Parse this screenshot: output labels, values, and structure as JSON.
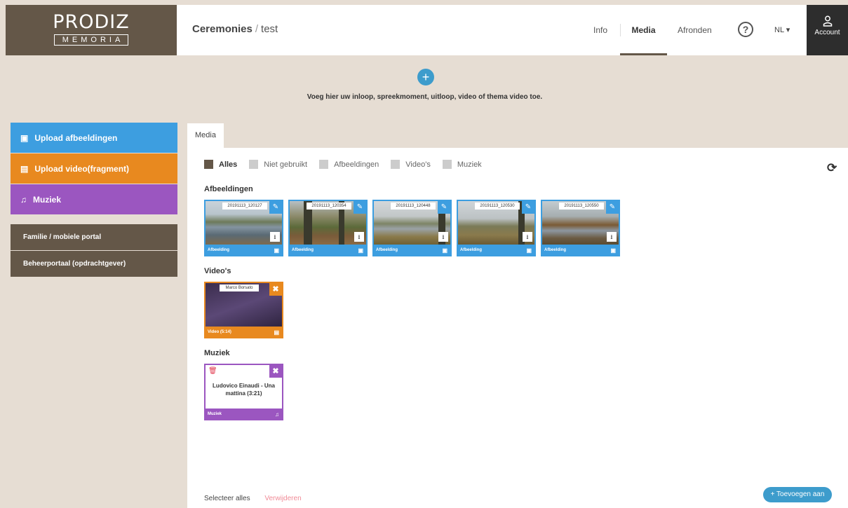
{
  "brand": {
    "name": "PRODIZ",
    "sub": "MEMORIA"
  },
  "header": {
    "crumb_main": "Ceremonies",
    "crumb_sep": "/",
    "crumb_sub": "test",
    "nav": {
      "info": "Info",
      "media": "Media",
      "afronden": "Afronden"
    },
    "help": "?",
    "lang": "NL ▾",
    "account": "Account"
  },
  "addbar": {
    "plus": "+",
    "text": "Voeg hier uw inloop, spreekmoment, uitloop, video of thema video toe."
  },
  "sidebar": {
    "upload_images": "Upload afbeeldingen",
    "upload_video": "Upload video(fragment)",
    "music": "Muziek",
    "family_portal": "Familie / mobiele portal",
    "admin_portal": "Beheerportaal (opdrachtgever)"
  },
  "media": {
    "tab": "Media",
    "filters": [
      "Alles",
      "Niet gebruikt",
      "Afbeeldingen",
      "Video's",
      "Muziek"
    ],
    "headings": {
      "images": "Afbeeldingen",
      "videos": "Video's",
      "music": "Muziek"
    },
    "images": [
      {
        "caption": "20191113_120127",
        "type": "Afbeelding"
      },
      {
        "caption": "20191113_120354",
        "type": "Afbeelding"
      },
      {
        "caption": "20191113_120448",
        "type": "Afbeelding"
      },
      {
        "caption": "20191113_120530",
        "type": "Afbeelding"
      },
      {
        "caption": "20191113_120550",
        "type": "Afbeelding"
      }
    ],
    "video": {
      "caption": "Marco Borsato",
      "type": "Video (5:14)"
    },
    "music_item": {
      "title": "Ludovico Einaudi - Una mattina (3:21)",
      "type": "Muziek"
    },
    "select_all": "Selecteer alles",
    "delete": "Verwijderen",
    "add": "+ Toevoegen aan"
  },
  "colors": {
    "brown": "#645748",
    "blue": "#3d9ee0",
    "orange": "#e8891f",
    "purple": "#9b56c0",
    "accent": "#3d9ccc"
  }
}
